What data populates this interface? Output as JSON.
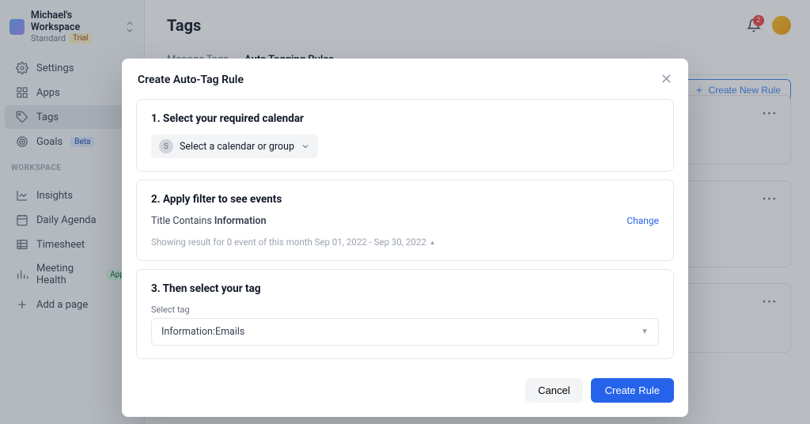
{
  "workspace": {
    "name": "Michael's Workspace",
    "plan": "Standard",
    "trial": "Trial"
  },
  "nav": {
    "settings": "Settings",
    "apps": "Apps",
    "tags": "Tags",
    "goals": "Goals",
    "goals_badge": "Beta",
    "section": "WORKSPACE",
    "insights": "Insights",
    "daily": "Daily Agenda",
    "timesheet": "Timesheet",
    "meeting": "Meeting Health",
    "meeting_badge": "App",
    "add": "Add a page"
  },
  "header": {
    "title": "Tags",
    "tab1": "Manage Tags",
    "tab2": "Auto Tagging Rules",
    "notif_count": "2",
    "create_new": "Create New Rule"
  },
  "modal": {
    "title": "Create Auto-Tag Rule",
    "step1": {
      "heading": "1. Select your required calendar",
      "chip_letter": "S",
      "chip_label": "Select a calendar or group"
    },
    "step2": {
      "heading": "2. Apply filter to see events",
      "prefix": "Title Contains ",
      "value": "Information",
      "change": "Change",
      "result": "Showing result for 0 event of this month Sep 01, 2022 - Sep 30, 2022"
    },
    "step3": {
      "heading": "3. Then select your tag",
      "label": "Select tag",
      "selected": "Information:Emails"
    },
    "cancel": "Cancel",
    "create": "Create Rule"
  }
}
